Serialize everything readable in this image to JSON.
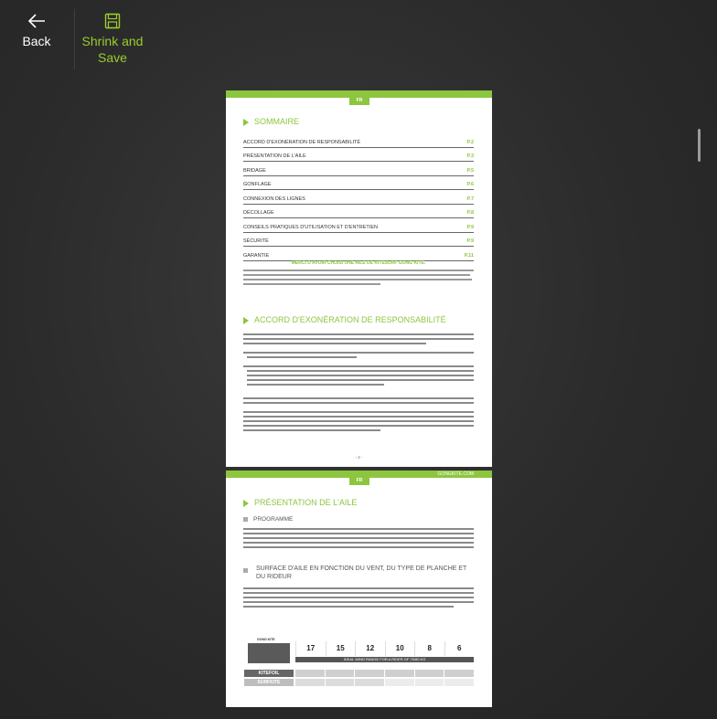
{
  "toolbar": {
    "back_label": "Back",
    "save_label": "Shrink and Save",
    "accent_color": "#9ccc2c"
  },
  "page1": {
    "lang_tag": "FR",
    "sommaire_title": "SOMMAIRE",
    "toc": [
      {
        "title": "ACCORD D'EXONÉRATION DE RESPONSABILITÉ",
        "page": "P.2"
      },
      {
        "title": "PRÉSENTATION DE L'AILE",
        "page": "P.3"
      },
      {
        "title": "BRIDAGE",
        "page": "P.5"
      },
      {
        "title": "GONFLAGE",
        "page": "P.6"
      },
      {
        "title": "CONNEXION DES LIGNES",
        "page": "P.7"
      },
      {
        "title": "DÉCOLLAGE",
        "page": "P.8"
      },
      {
        "title": "CONSEILS PRATIQUES D'UTILISATION ET D'ENTRETIEN",
        "page": "P.9"
      },
      {
        "title": "SÉCURITÉ",
        "page": "P.9"
      },
      {
        "title": "GARANTIE",
        "page": "P.11"
      }
    ],
    "merci": "MERCI D'AVOIR CHOISI UNE AILE DE KITESURF GONG KITE.",
    "accord_title": "ACCORD D'EXONÉRATION DE RESPONSABILITÉ",
    "page_number": "- 2 -"
  },
  "page2": {
    "lang_tag": "FR",
    "url": "GONGKITE.COM",
    "title": "PRÉSENTATION DE L'AILE",
    "sub1": "PROGRAMME",
    "sub2": "SURFACE D'AILE EN FONCTION DU VENT, DU TYPE DE PLANCHE ET DU RIDEUR",
    "wind_brand": "GONG KITE",
    "wind_numbers": [
      "17",
      "15",
      "12",
      "10",
      "8",
      "6"
    ],
    "wind_bar": "IDEAL WIND RANGE FOR A RIDER OF 75/80 KG",
    "row_kitefoil": "KITEFOIL",
    "row_surfkite": "SURFKITE"
  }
}
